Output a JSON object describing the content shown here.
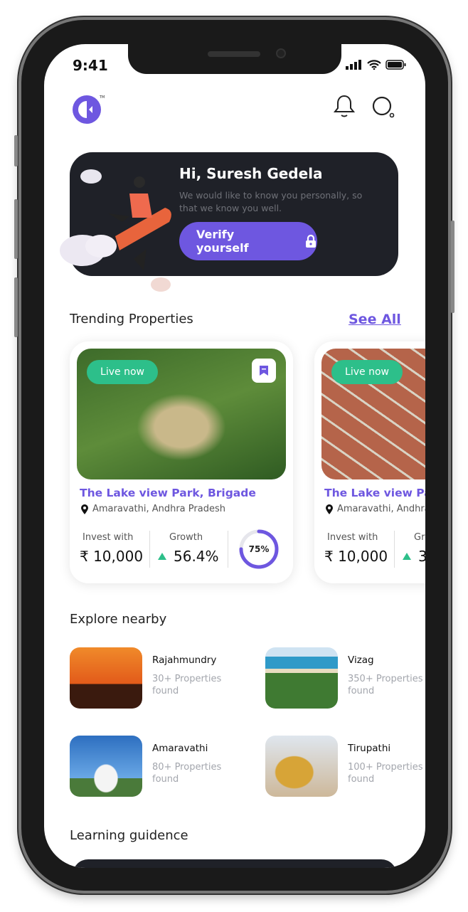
{
  "status_bar": {
    "time": "9:41"
  },
  "header": {
    "logo": "brand-logo",
    "icons": [
      "bell-icon",
      "search-icon"
    ]
  },
  "banner": {
    "greeting": "Hi, Suresh Gedela",
    "message": "We would like to know you personally, so that we know you well.",
    "cta": "Verify yourself"
  },
  "trending": {
    "title": "Trending Properties",
    "see_all": "See All",
    "cards": [
      {
        "badge": "Live now",
        "title": "The Lake view Park, Brigade",
        "location": "Amaravathi, Andhra Pradesh",
        "invest_label": "Invest with",
        "invest_value": "₹ 10,000",
        "growth_label": "Growth",
        "growth_value": "56.4%",
        "progress_label": "75%",
        "progress": 0.75
      },
      {
        "badge": "Live now",
        "title": "The Lake view Park, Brigade",
        "location": "Amaravathi, Andhra Pradesh",
        "invest_label": "Invest with",
        "invest_value": "₹ 10,000",
        "growth_label": "Growth",
        "growth_value": "3"
      }
    ]
  },
  "explore": {
    "title": "Explore nearby",
    "places": [
      {
        "name": "Rajahmundry",
        "count": "30+ Properties found"
      },
      {
        "name": "Vizag",
        "count": "350+ Properties found"
      },
      {
        "name": "Amaravathi",
        "count": "80+ Properties found"
      },
      {
        "name": "Tirupathi",
        "count": "100+ Properties found"
      }
    ]
  },
  "learning": {
    "title": "Learning guidence"
  },
  "colors": {
    "accent": "#6e57e0",
    "live": "#2dbf8a",
    "banner": "#1f2128",
    "growth": "#2dbf8a"
  }
}
